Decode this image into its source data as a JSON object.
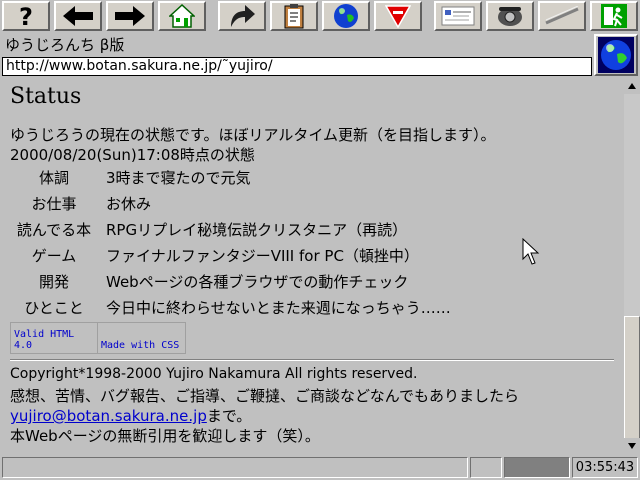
{
  "window": {
    "title": "ゆうじろんち β版",
    "url": "http://www.botan.sakura.ne.jp/˜yujiro/"
  },
  "toolbar": {
    "buttons": [
      {
        "name": "help-button",
        "icon": "question-mark-icon"
      },
      {
        "name": "back-button",
        "icon": "arrow-left-icon"
      },
      {
        "name": "forward-button",
        "icon": "arrow-right-icon"
      },
      {
        "name": "home-button",
        "icon": "house-icon"
      },
      {
        "name": "reload-button",
        "icon": "curved-arrow-icon"
      },
      {
        "name": "bookmarks-button",
        "icon": "clipboard-icon"
      },
      {
        "name": "internet-button",
        "icon": "globe-icon"
      },
      {
        "name": "stop-button",
        "icon": "stop-sign-icon"
      },
      {
        "name": "page-button",
        "icon": "document-icon"
      },
      {
        "name": "phone-button",
        "icon": "telephone-icon"
      },
      {
        "name": "disconnect-button",
        "icon": "cable-icon"
      },
      {
        "name": "exit-button",
        "icon": "exit-door-icon"
      }
    ]
  },
  "page": {
    "heading": "Status",
    "intro": "ゆうじろうの現在の状態です。ほぼリアルタイム更新（を目指します）。",
    "timestamp": "2000/08/20(Sun)17:08時点の状態",
    "rows": [
      {
        "key": "体調",
        "value": "3時まで寝たので元気"
      },
      {
        "key": "お仕事",
        "value": "お休み"
      },
      {
        "key": "読んでる本",
        "value": "RPGリプレイ秘境伝説クリスタニア（再読）"
      },
      {
        "key": "ゲーム",
        "value": "ファイナルファンタジーVIII for PC（頓挫中）"
      },
      {
        "key": "開発",
        "value": "Webページの各種ブラウザでの動作チェック"
      },
      {
        "key": "ひとこと",
        "value": "今日中に終わらせないとまた来週になっちゃう……"
      }
    ],
    "badges": {
      "html": "Valid HTML 4.0",
      "css": "Made with CSS"
    },
    "footer": {
      "copyright": "Copyright*1998-2000 Yujiro Nakamura All rights reserved.",
      "feedback": "感想、苦情、バグ報告、ご指導、ご鞭撻、ご商談などなんでもありましたら",
      "email": "yujiro@botan.sakura.ne.jp",
      "email_suffix": "まで。",
      "note": "本Webページの無断引用を歓迎します（笑）。"
    }
  },
  "statusbar": {
    "clock": "03:55:43"
  },
  "colors": {
    "background": "#c0c0c0",
    "link": "#0000cc",
    "progress": "#808080"
  }
}
